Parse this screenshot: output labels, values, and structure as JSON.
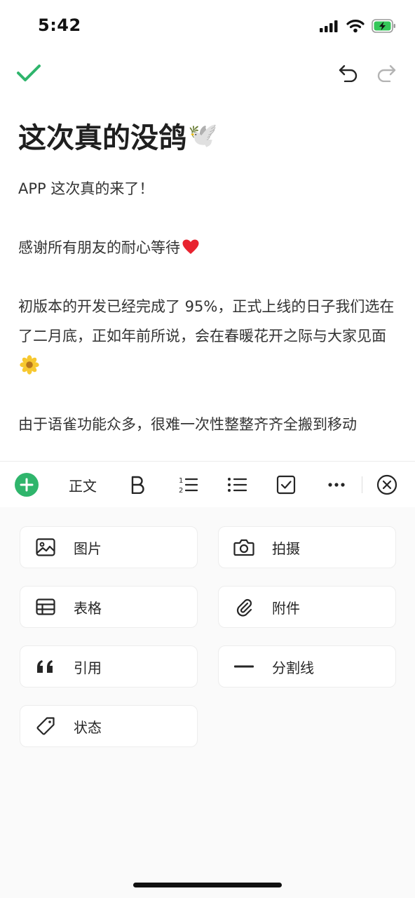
{
  "status_bar": {
    "time": "5:42"
  },
  "document": {
    "title": "这次真的没鸽",
    "title_emoji": "🕊️",
    "paragraphs": [
      "APP 这次真的来了！",
      "感谢所有朋友的耐心等待",
      "初版本的开发已经完成了 95%，正式上线的日子我们选在了二月底，正如年前所说，会在春暖花开之际与大家见面",
      "由于语雀功能众多，很难一次性整整齐齐全搬到移动"
    ]
  },
  "toolbar": {
    "text_style_label": "正文"
  },
  "insert_panel": {
    "items": [
      {
        "label": "图片",
        "icon": "image-icon"
      },
      {
        "label": "拍摄",
        "icon": "camera-icon"
      },
      {
        "label": "表格",
        "icon": "table-icon"
      },
      {
        "label": "附件",
        "icon": "attachment-icon"
      },
      {
        "label": "引用",
        "icon": "quote-icon"
      },
      {
        "label": "分割线",
        "icon": "divider-icon"
      },
      {
        "label": "状态",
        "icon": "tag-icon"
      }
    ]
  },
  "colors": {
    "accent": "#2fb56c",
    "text": "#262626",
    "panel_bg": "#fafafa"
  }
}
